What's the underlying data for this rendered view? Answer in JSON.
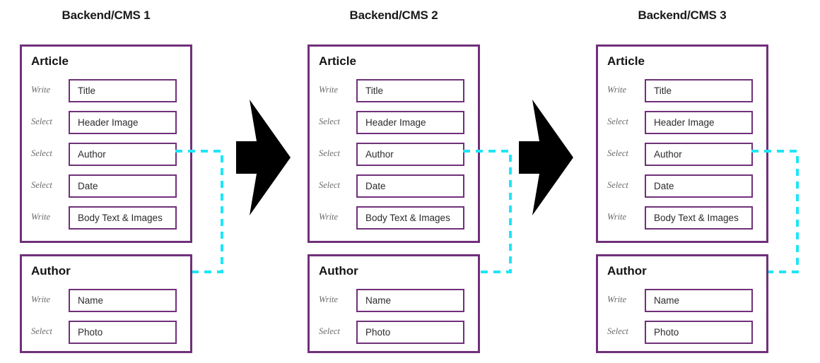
{
  "diagram": {
    "title_prefix": "Backend/CMS",
    "accent_purple": "#70307A",
    "connector_cyan": "#1FE5F7",
    "arrow_color": "#000000",
    "label_color": "#6b6b6b"
  },
  "columns": [
    {
      "title": "Backend/CMS 1",
      "cards": [
        {
          "heading": "Article",
          "fields": [
            {
              "action": "Write",
              "name": "Title"
            },
            {
              "action": "Select",
              "name": "Header Image"
            },
            {
              "action": "Select",
              "name": "Author"
            },
            {
              "action": "Select",
              "name": "Date"
            },
            {
              "action": "Write",
              "name": "Body Text & Images"
            }
          ]
        },
        {
          "heading": "Author",
          "fields": [
            {
              "action": "Write",
              "name": "Name"
            },
            {
              "action": "Select",
              "name": "Photo"
            }
          ]
        }
      ]
    },
    {
      "title": "Backend/CMS 2",
      "cards": [
        {
          "heading": "Article",
          "fields": [
            {
              "action": "Write",
              "name": "Title"
            },
            {
              "action": "Select",
              "name": "Header Image"
            },
            {
              "action": "Select",
              "name": "Author"
            },
            {
              "action": "Select",
              "name": "Date"
            },
            {
              "action": "Write",
              "name": "Body Text & Images"
            }
          ]
        },
        {
          "heading": "Author",
          "fields": [
            {
              "action": "Write",
              "name": "Name"
            },
            {
              "action": "Select",
              "name": "Photo"
            }
          ]
        }
      ]
    },
    {
      "title": "Backend/CMS 3",
      "cards": [
        {
          "heading": "Article",
          "fields": [
            {
              "action": "Write",
              "name": "Title"
            },
            {
              "action": "Select",
              "name": "Header Image"
            },
            {
              "action": "Select",
              "name": "Author"
            },
            {
              "action": "Select",
              "name": "Date"
            },
            {
              "action": "Write",
              "name": "Body Text & Images"
            }
          ]
        },
        {
          "heading": "Author",
          "fields": [
            {
              "action": "Write",
              "name": "Name"
            },
            {
              "action": "Select",
              "name": "Photo"
            }
          ]
        }
      ]
    }
  ],
  "arrows": [
    {
      "name": "flow-arrow-1-to-2"
    },
    {
      "name": "flow-arrow-2-to-3"
    }
  ],
  "relations": [
    {
      "from": "Article.Author",
      "to": "Author",
      "column": 1
    },
    {
      "from": "Article.Author",
      "to": "Author",
      "column": 2
    },
    {
      "from": "Article.Author",
      "to": "Author",
      "column": 3
    }
  ]
}
